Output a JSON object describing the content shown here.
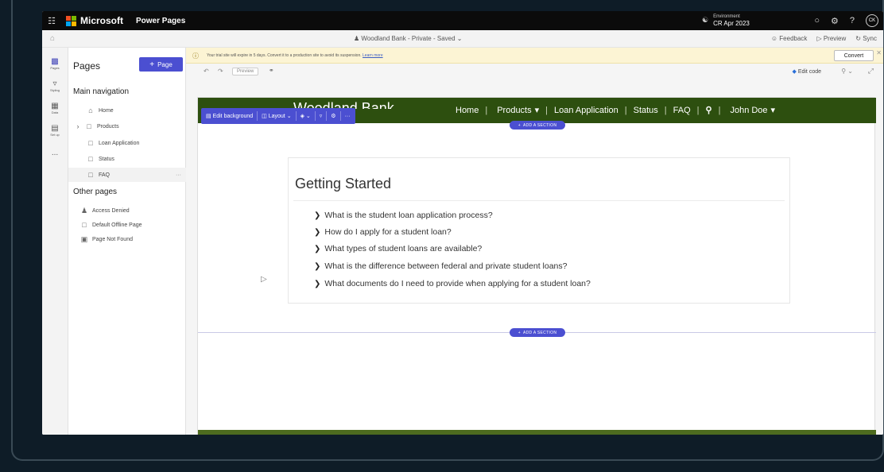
{
  "topbar": {
    "brand": "Microsoft",
    "product": "Power Pages",
    "env_label": "Environment",
    "env_value": "CR Apr 2023",
    "avatar": "CK",
    "brand_colors": [
      "#f25022",
      "#7fba00",
      "#00a4ef",
      "#ffb900"
    ]
  },
  "cmdbar": {
    "site": "Woodland Bank - Private - Saved",
    "feedback": "Feedback",
    "preview": "Preview",
    "sync": "Sync"
  },
  "rail": [
    {
      "label": "Pages",
      "icon": "page-icon"
    },
    {
      "label": "Styling",
      "icon": "brush-icon"
    },
    {
      "label": "Data",
      "icon": "table-icon"
    },
    {
      "label": "Set up",
      "icon": "setup-icon"
    },
    {
      "label": "...",
      "icon": "more-icon"
    }
  ],
  "pages_panel": {
    "title": "Pages",
    "add_label": "Page",
    "main_nav_title": "Main navigation",
    "main_nav": [
      "Home",
      "Products",
      "Loan Application",
      "Status",
      "FAQ"
    ],
    "other_title": "Other pages",
    "other": [
      "Access Denied",
      "Default Offline Page",
      "Page Not Found"
    ]
  },
  "trial": {
    "message": "Your trial site will expire in 5 days. Convert it to a production site to avoid its suspension.",
    "link": "Learn more",
    "convert": "Convert"
  },
  "editor": {
    "preview": "Preview",
    "edit_code": "Edit code"
  },
  "site": {
    "name": "Woodland Bank",
    "nav": [
      "Home",
      "Products",
      "Loan Application",
      "Status",
      "FAQ",
      "John Doe"
    ],
    "edit_background": "Edit background",
    "layout": "Layout",
    "add_section": "ADD A SECTION",
    "heading": "Getting Started",
    "faqs": [
      "What is the student loan application process?",
      "How do I apply for a student loan?",
      "What types of student loans are available?",
      "What is the difference between federal and private student loans?",
      "What documents do I need to provide when applying for a student loan?"
    ]
  },
  "colors": {
    "accent": "#4b4fd1",
    "site_nav": "#2d4f0f",
    "trial_banner": "#fcf4d4"
  }
}
